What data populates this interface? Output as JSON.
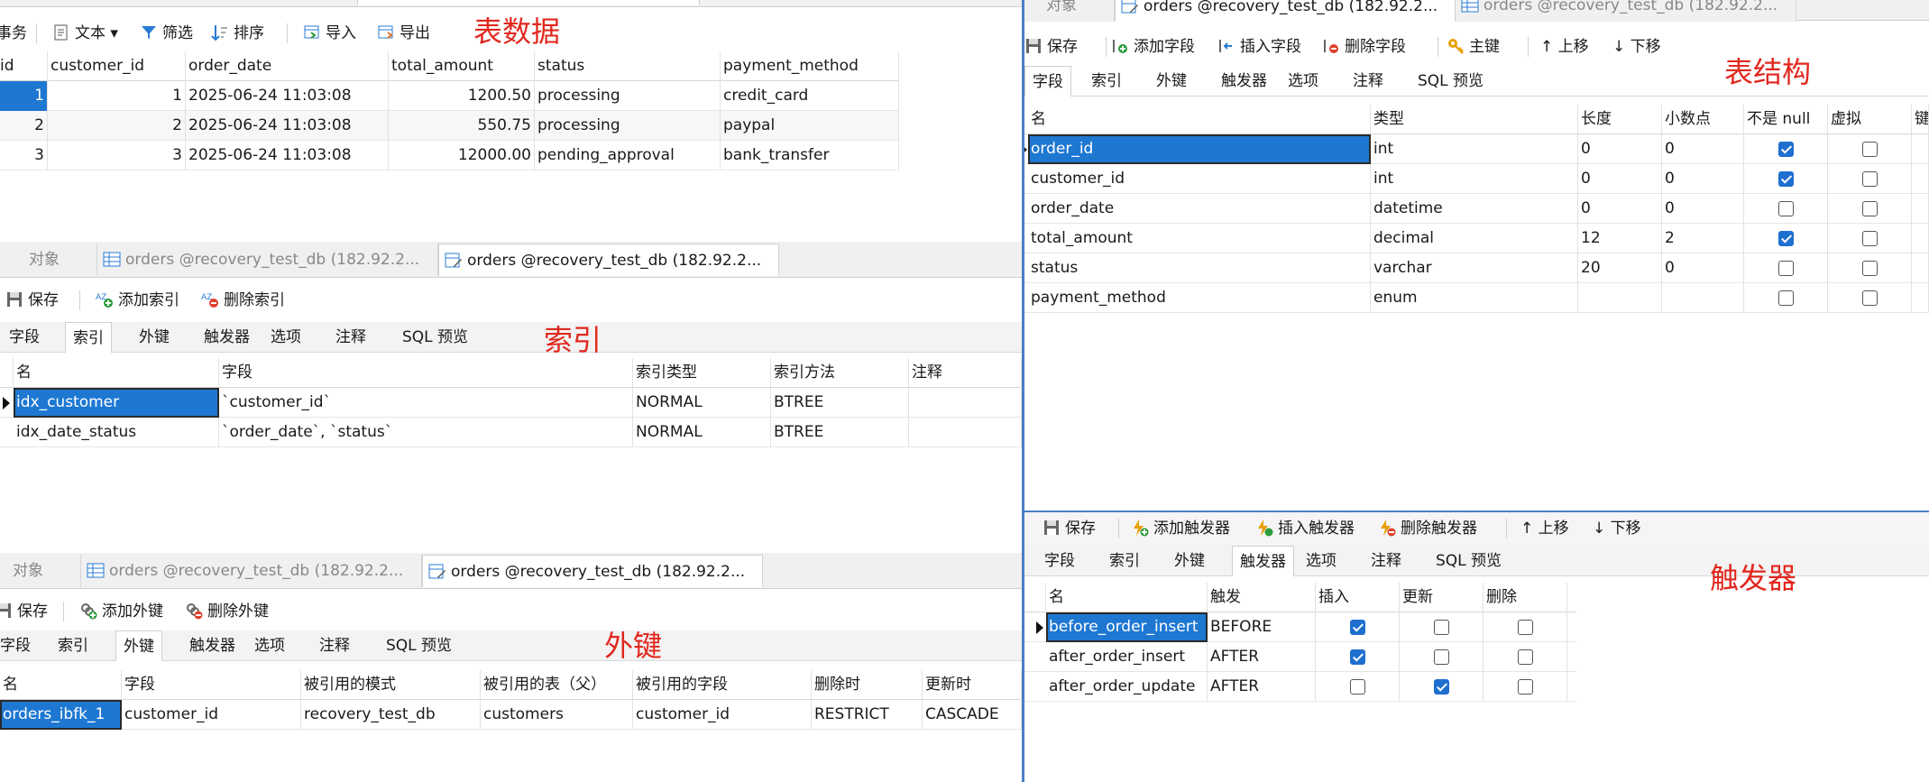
{
  "annotations": {
    "table_data": "表数据",
    "structure": "表结构",
    "indexes": "索引",
    "foreign_keys": "外键",
    "triggers": "触发器"
  },
  "data_panel": {
    "toolbar": {
      "transaction": "事务",
      "text": "文本",
      "filter": "筛选",
      "sort": "排序",
      "import": "导入",
      "export": "导出"
    },
    "columns": [
      "id",
      "customer_id",
      "order_date",
      "total_amount",
      "status",
      "payment_method"
    ],
    "rows": [
      [
        "1",
        "1",
        "2025-06-24 11:03:08",
        "1200.50",
        "processing",
        "credit_card"
      ],
      [
        "2",
        "2",
        "2025-06-24 11:03:08",
        "550.75",
        "processing",
        "paypal"
      ],
      [
        "3",
        "3",
        "2025-06-24 11:03:08",
        "12000.00",
        "pending_approval",
        "bank_transfer"
      ]
    ]
  },
  "tabs": {
    "objects": "对象",
    "orders_table": "orders @recovery_test_db (182.92.2...",
    "orders_design": "orders @recovery_test_db (182.92.2..."
  },
  "subtabs": {
    "fields": "字段",
    "indexes": "索引",
    "foreign_keys": "外键",
    "triggers": "触发器",
    "options": "选项",
    "comments": "注释",
    "sql_preview": "SQL 预览"
  },
  "index_panel": {
    "toolbar": {
      "save": "保存",
      "add_index": "添加索引",
      "delete_index": "删除索引"
    },
    "columns": [
      "名",
      "字段",
      "索引类型",
      "索引方法",
      "注释"
    ],
    "rows": [
      [
        "idx_customer",
        "`customer_id`",
        "NORMAL",
        "BTREE",
        ""
      ],
      [
        "idx_date_status",
        "`order_date`, `status`",
        "NORMAL",
        "BTREE",
        ""
      ]
    ]
  },
  "fk_panel": {
    "toolbar": {
      "save": "保存",
      "add_fk": "添加外键",
      "delete_fk": "删除外键"
    },
    "columns": [
      "名",
      "字段",
      "被引用的模式",
      "被引用的表（父）",
      "被引用的字段",
      "删除时",
      "更新时"
    ],
    "rows": [
      [
        "orders_ibfk_1",
        "customer_id",
        "recovery_test_db",
        "customers",
        "customer_id",
        "RESTRICT",
        "CASCADE"
      ]
    ]
  },
  "structure_panel": {
    "toolbar": {
      "save": "保存",
      "add_field": "添加字段",
      "insert_field": "插入字段",
      "delete_field": "删除字段",
      "primary_key": "主键",
      "move_up": "上移",
      "move_down": "下移"
    },
    "columns": [
      "名",
      "类型",
      "长度",
      "小数点",
      "不是 null",
      "虚拟"
    ],
    "rows": [
      {
        "name": "order_id",
        "type": "int",
        "length": "0",
        "decimals": "0",
        "not_null": true,
        "virtual": false
      },
      {
        "name": "customer_id",
        "type": "int",
        "length": "0",
        "decimals": "0",
        "not_null": true,
        "virtual": false
      },
      {
        "name": "order_date",
        "type": "datetime",
        "length": "0",
        "decimals": "0",
        "not_null": false,
        "virtual": false
      },
      {
        "name": "total_amount",
        "type": "decimal",
        "length": "12",
        "decimals": "2",
        "not_null": true,
        "virtual": false
      },
      {
        "name": "status",
        "type": "varchar",
        "length": "20",
        "decimals": "0",
        "not_null": false,
        "virtual": false
      },
      {
        "name": "payment_method",
        "type": "enum",
        "length": "",
        "decimals": "",
        "not_null": false,
        "virtual": false
      }
    ]
  },
  "trigger_panel": {
    "toolbar": {
      "save": "保存",
      "add_trigger": "添加触发器",
      "insert_trigger": "插入触发器",
      "delete_trigger": "删除触发器",
      "move_up": "上移",
      "move_down": "下移"
    },
    "columns": [
      "名",
      "触发",
      "插入",
      "更新",
      "删除"
    ],
    "rows": [
      {
        "name": "before_order_insert",
        "timing": "BEFORE",
        "insert": true,
        "update": false,
        "delete": false
      },
      {
        "name": "after_order_insert",
        "timing": "AFTER",
        "insert": true,
        "update": false,
        "delete": false
      },
      {
        "name": "after_order_update",
        "timing": "AFTER",
        "insert": false,
        "update": true,
        "delete": false
      }
    ]
  },
  "colors": {
    "accent": "#1e78d2",
    "annotation": "#e1271e",
    "check": "#1e6fcf"
  }
}
